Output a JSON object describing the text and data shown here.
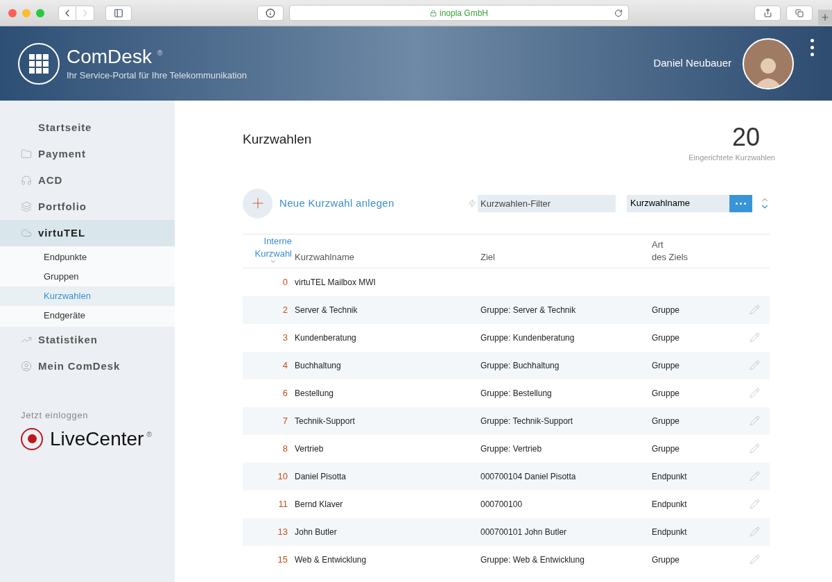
{
  "browser": {
    "address": "inopla GmbH",
    "secure": true
  },
  "header": {
    "brand": "ComDesk",
    "registered": "®",
    "tagline": "Ihr Service-Portal für Ihre Telekommunikation",
    "user_name": "Daniel Neubauer"
  },
  "sidebar": {
    "items": [
      {
        "label": "Startseite",
        "selected": false
      },
      {
        "label": "Payment",
        "selected": false
      },
      {
        "label": "ACD",
        "selected": false
      },
      {
        "label": "Portfolio",
        "selected": false
      },
      {
        "label": "virtuTEL",
        "selected": true,
        "children": [
          {
            "label": "Endpunkte",
            "selected": false
          },
          {
            "label": "Gruppen",
            "selected": false
          },
          {
            "label": "Kurzwahlen",
            "selected": true
          },
          {
            "label": "Endgeräte",
            "selected": false
          }
        ]
      },
      {
        "label": "Statistiken",
        "selected": false
      },
      {
        "label": "Mein ComDesk",
        "selected": false
      }
    ],
    "login_hint": "Jetzt einloggen",
    "livecenter": "LiveCenter",
    "livecenter_mark": "®"
  },
  "page": {
    "title": "Kurzwahlen",
    "count": "20",
    "count_label": "Eingerichtete Kurzwahlen",
    "new_button": "Neue Kurzwahl anlegen",
    "filter": {
      "placeholder": "Kurzwahlen-Filter"
    },
    "sort_field": {
      "value": "Kurzwahlname"
    }
  },
  "table": {
    "columns": [
      {
        "lines": [
          "Interne",
          "Kurzwahl"
        ],
        "sorted": true
      },
      {
        "lines": [
          "Kurzwahlname"
        ],
        "sorted": false
      },
      {
        "lines": [
          "Ziel"
        ],
        "sorted": false
      },
      {
        "lines": [
          "Art",
          "des Ziels"
        ],
        "sorted": false
      }
    ],
    "rows": [
      {
        "number": "0",
        "name": "virtuTEL Mailbox MWI",
        "editable": false
      },
      {
        "number": "2",
        "name": "Server & Technik",
        "target": "Gruppe: Server & Technik",
        "type": "Gruppe",
        "editable": true
      },
      {
        "number": "3",
        "name": "Kundenberatung",
        "target": "Gruppe: Kundenberatung",
        "type": "Gruppe",
        "editable": true
      },
      {
        "number": "4",
        "name": "Buchhaltung",
        "target": "Gruppe: Buchhaltung",
        "type": "Gruppe",
        "editable": true
      },
      {
        "number": "6",
        "name": "Bestellung",
        "target": "Gruppe: Bestellung",
        "type": "Gruppe",
        "editable": true
      },
      {
        "number": "7",
        "name": "Technik-Support",
        "target": "Gruppe: Technik-Support",
        "type": "Gruppe",
        "editable": true
      },
      {
        "number": "8",
        "name": "Vertrieb",
        "target": "Gruppe: Vertrieb",
        "type": "Gruppe",
        "editable": true
      },
      {
        "number": "10",
        "name": "Daniel Pisotta",
        "target": "000700104 Daniel Pisotta",
        "type": "Endpunkt",
        "editable": true
      },
      {
        "number": "11",
        "name": "Bernd Klaver",
        "target": "000700100",
        "type": "Endpunkt",
        "editable": true
      },
      {
        "number": "13",
        "name": "John Butler",
        "target": "000700101 John Butler",
        "type": "Endpunkt",
        "editable": true
      },
      {
        "number": "15",
        "name": "Web & Entwicklung",
        "target": "Gruppe: Web & Entwicklung",
        "type": "Gruppe",
        "editable": true
      }
    ]
  }
}
